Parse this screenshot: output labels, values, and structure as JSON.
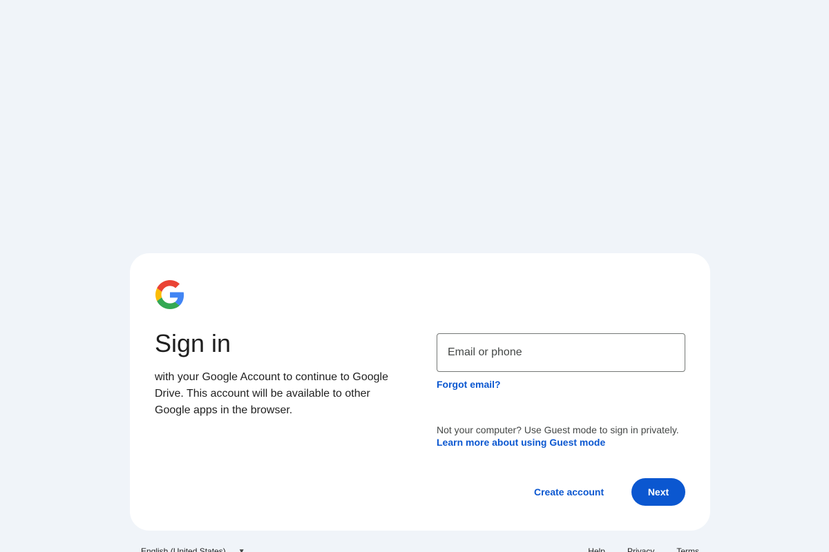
{
  "signin": {
    "title": "Sign in",
    "subtitle": "with your Google Account to continue to Google Drive. This account will be available to other Google apps in the browser.",
    "email_placeholder": "Email or phone",
    "forgot_email": "Forgot email?",
    "guest_text": "Not your computer? Use Guest mode to sign in privately.",
    "guest_link": "Learn more about using Guest mode",
    "create_account": "Create account",
    "next": "Next"
  },
  "footer": {
    "language": "English (United States)",
    "help": "Help",
    "privacy": "Privacy",
    "terms": "Terms"
  },
  "icons": {
    "logo": "google-g-logo",
    "language_caret": "caret-down-icon"
  },
  "colors": {
    "accent": "#0b57d0",
    "page_bg": "#f0f4f9",
    "card_bg": "#ffffff"
  }
}
